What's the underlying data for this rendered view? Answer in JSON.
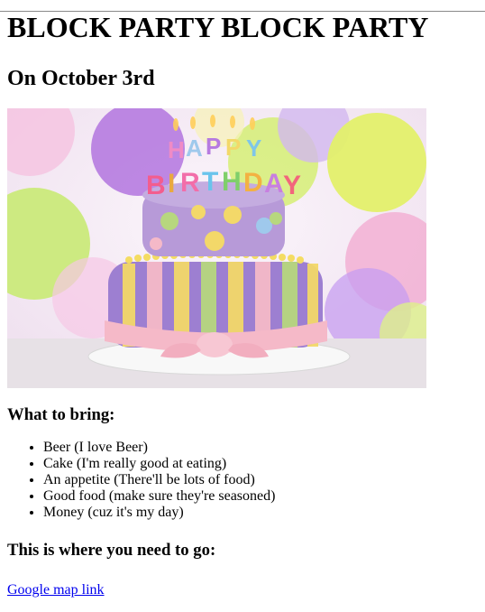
{
  "page": {
    "title": "BLOCK PARTY BLOCK PARTY",
    "subtitle": "On October 3rd"
  },
  "hero": {
    "alt": "Birthday cake",
    "candle_letters_top": [
      "H",
      "A",
      "P",
      "P",
      "Y"
    ],
    "candle_letters_bottom": [
      "B",
      "I",
      "R",
      "T",
      "H",
      "D",
      "A",
      "Y"
    ],
    "colors": {
      "background": "#f3e6f2",
      "cake_top": "#b79ad8",
      "cake_bottom_stripe_purple": "#9d7fd1",
      "cake_bottom_stripe_yellow": "#f3d869",
      "cake_bottom_stripe_green": "#b7d77e",
      "ribbon": "#f5b9c8"
    }
  },
  "bring": {
    "heading": "What to bring:",
    "items": [
      "Beer (I love Beer)",
      "Cake (I'm really good at eating)",
      "An appetite (There'll be lots of food)",
      "Good food (make sure they're seasoned)",
      "Money (cuz it's my day)"
    ]
  },
  "directions": {
    "heading": "This is where you need to go:",
    "link_text": "Google map link"
  }
}
